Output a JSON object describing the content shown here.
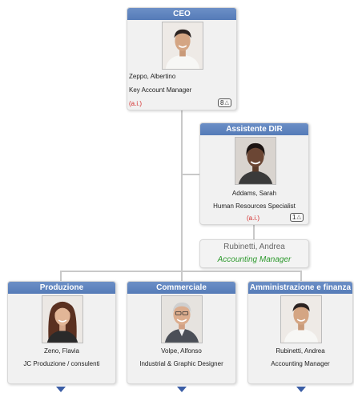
{
  "ceo": {
    "header": "CEO",
    "name": "Zeppo, Albertino",
    "role": "Key Account Manager",
    "ai_tag": "(a.i.)",
    "badge_count": "8"
  },
  "assistant": {
    "header": "Assistente DIR",
    "name": "Addams, Sarah",
    "role": "Human Resources Specialist",
    "ai_tag": "(a.i.)",
    "badge_count": "1"
  },
  "assistant_box": {
    "name": "Rubinetti, Andrea",
    "role": "Accounting Manager"
  },
  "departments": [
    {
      "header": "Produzione",
      "name": "Zeno, Flavia",
      "role": "JC Produzione / consulenti"
    },
    {
      "header": "Commerciale",
      "name": "Volpe, Alfonso",
      "role": "Industrial & Graphic Designer"
    },
    {
      "header": "Amministrazione e finanza",
      "name": "Rubinetti, Andrea",
      "role": "Accounting Manager"
    }
  ],
  "colors": {
    "header_blue": "#5b80bd",
    "ai_red": "#d42b2b",
    "assistant_role_green": "#2e9a2e",
    "expand_arrow": "#3b5ea6"
  },
  "icons": {
    "badge": "triangle-up-icon",
    "expand": "triangle-down-icon"
  }
}
